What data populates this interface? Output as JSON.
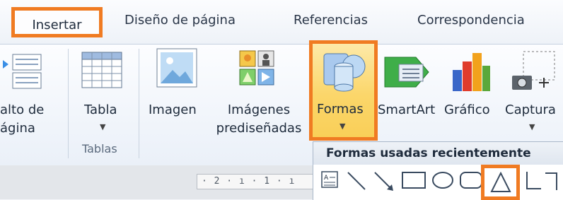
{
  "tabs": {
    "insertar": "Insertar",
    "diseno": "Diseño de página",
    "referencias": "Referencias",
    "correspondencia": "Correspondencia"
  },
  "ribbon": {
    "salto": [
      "alto de",
      "ágina"
    ],
    "tabla": "Tabla",
    "imagen": "Imagen",
    "imagenes_predisenadas": [
      "Imágenes",
      "prediseñadas"
    ],
    "formas": "Formas",
    "smartart": "SmartArt",
    "grafico": "Gráfico",
    "captura": "Captura",
    "group_tablas": "Tablas"
  },
  "ruler": {
    "text": "· 2 · ı · 1 · ı"
  },
  "shapes_panel": {
    "title": "Formas usadas recientemente"
  },
  "colors": {
    "highlight": "#f07b22",
    "formas_bg": "#fbd66a"
  }
}
